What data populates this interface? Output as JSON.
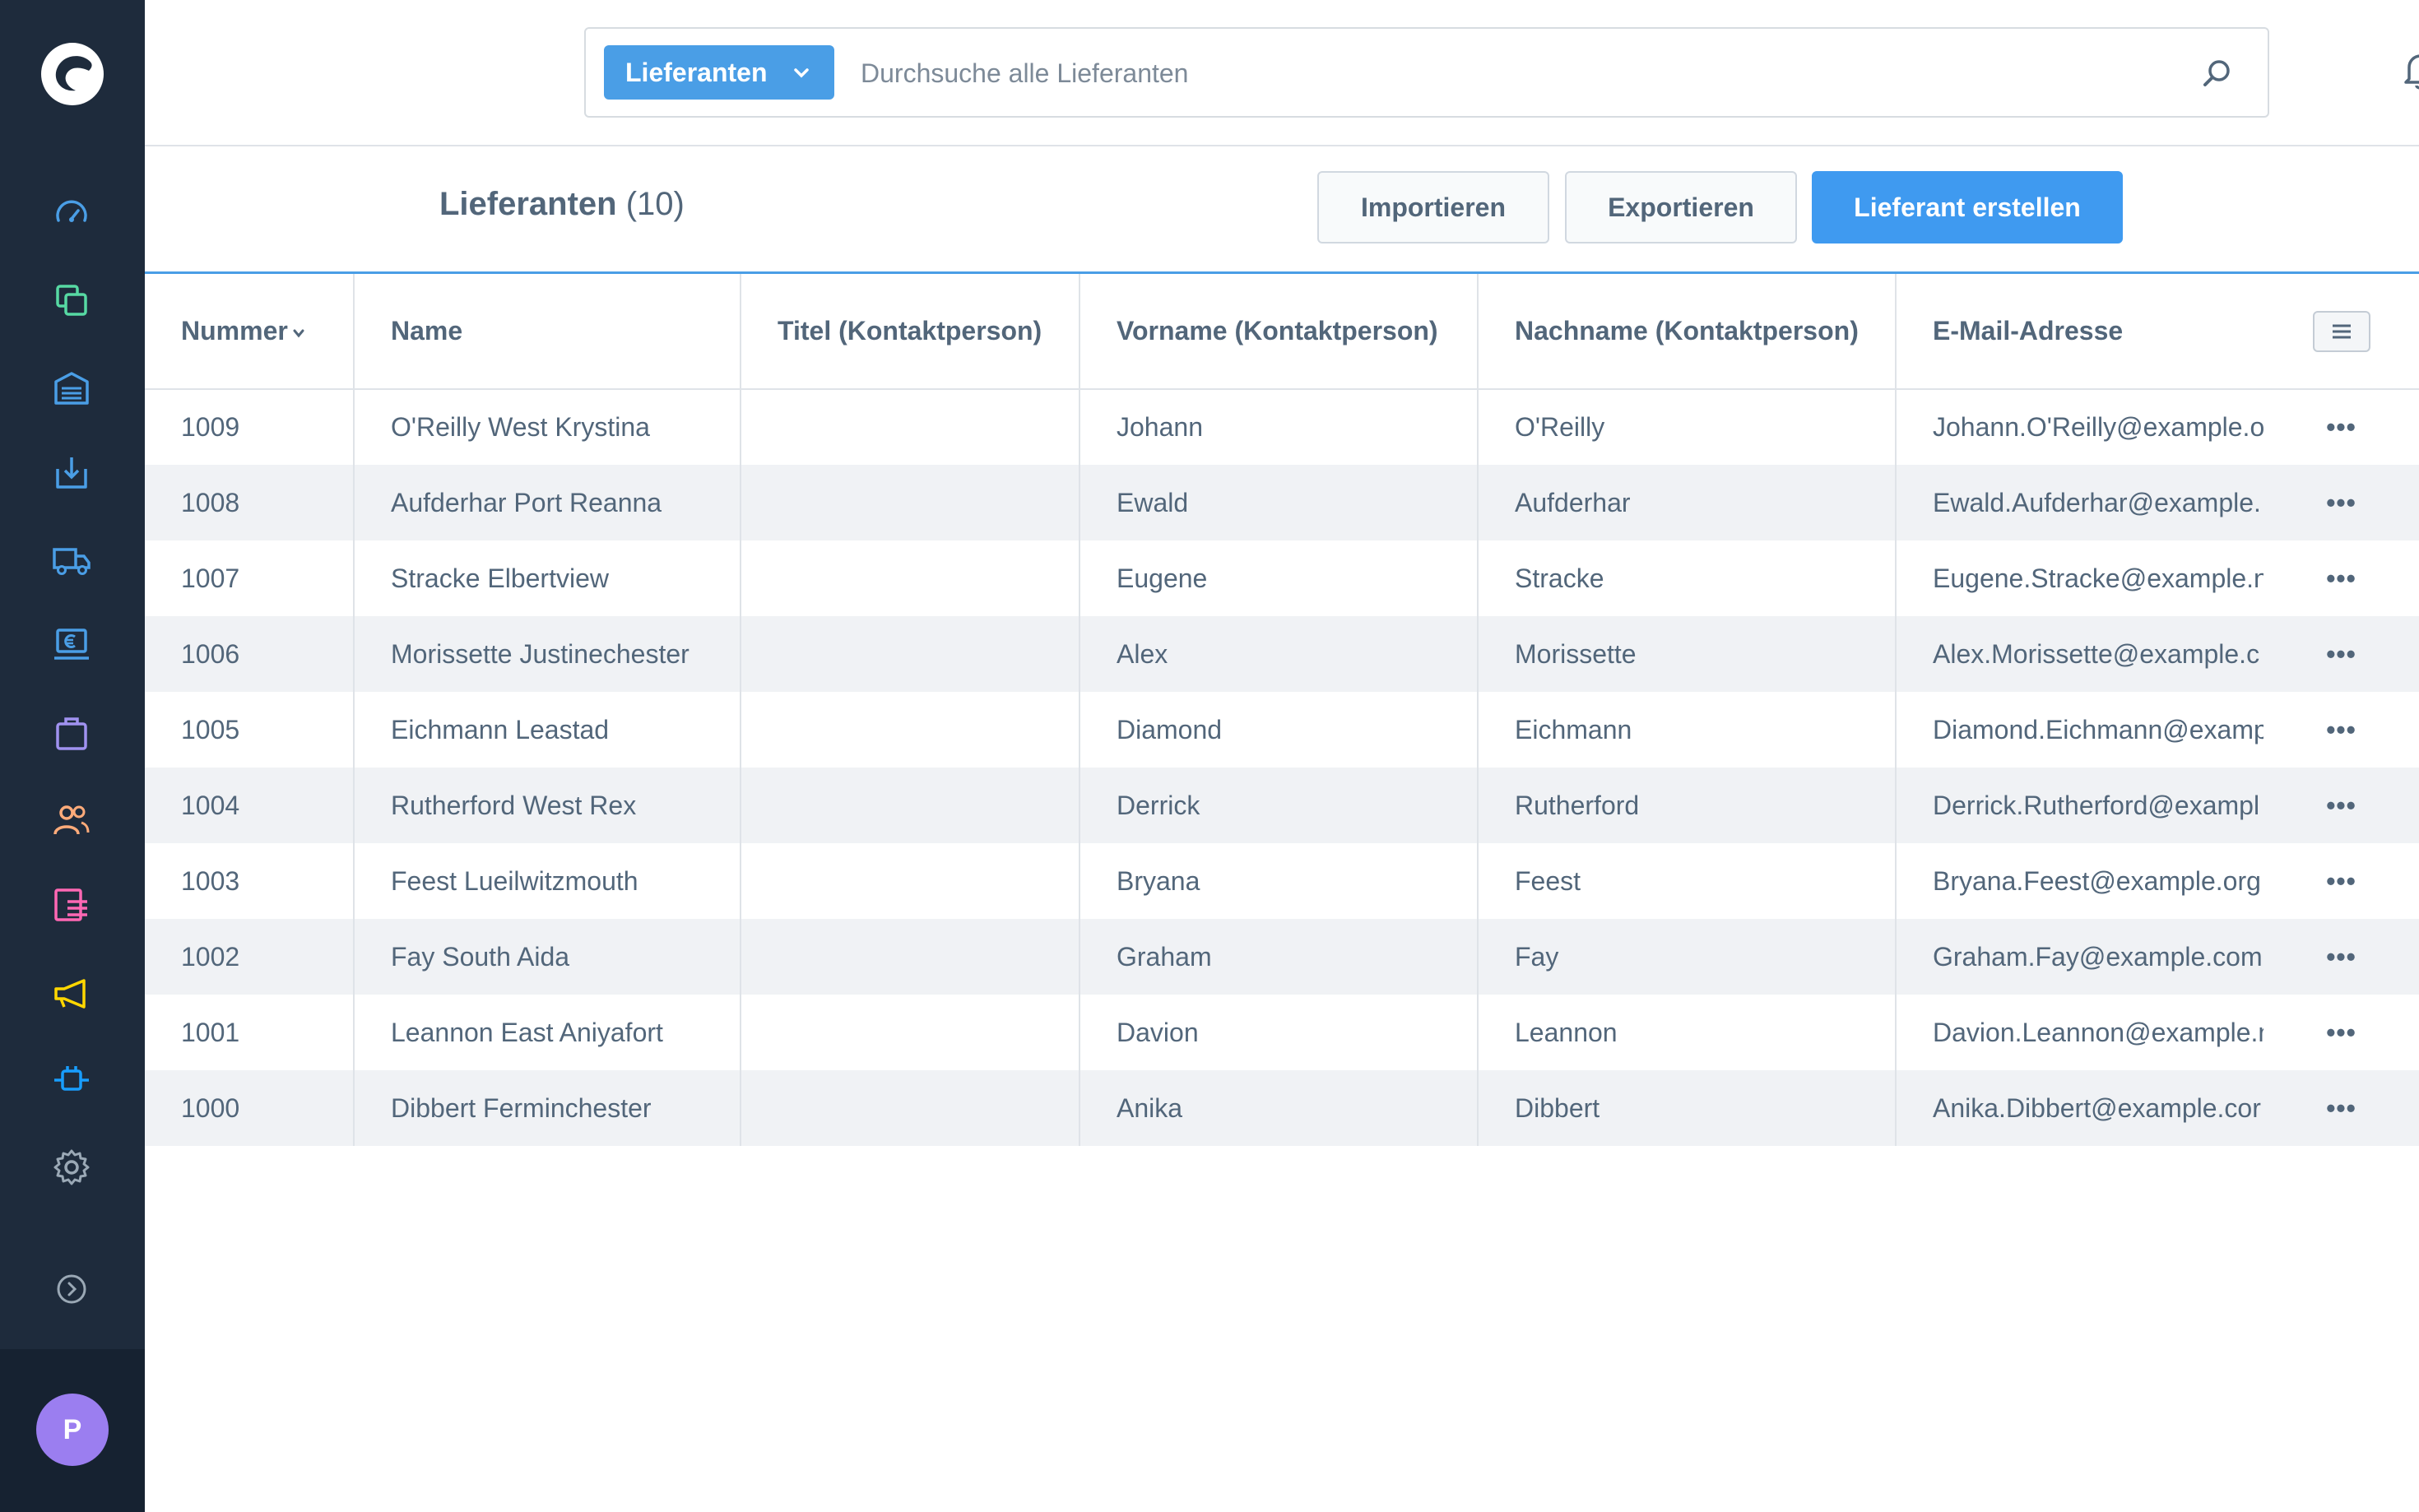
{
  "colors": {
    "sidebar_bg": "#1e2b3c",
    "accent": "#3f9af0",
    "avatar_bg": "#9b7ef0",
    "text": "#52667a"
  },
  "sidebar": {
    "items": [
      {
        "icon": "dashboard-icon",
        "color": "#4a9ee6"
      },
      {
        "icon": "catalogues-icon",
        "color": "#57d9a3"
      },
      {
        "icon": "warehouse-icon",
        "color": "#4a9ee6"
      },
      {
        "icon": "incoming-goods-icon",
        "color": "#4a9ee6"
      },
      {
        "icon": "shipping-truck-icon",
        "color": "#4a9ee6"
      },
      {
        "icon": "accounting-icon",
        "color": "#4a9ee6"
      },
      {
        "icon": "orders-bag-icon",
        "color": "#a092f0"
      },
      {
        "icon": "customers-icon",
        "color": "#ffab7a"
      },
      {
        "icon": "content-icon",
        "color": "#ff68b4"
      },
      {
        "icon": "marketing-megaphone-icon",
        "color": "#ffd700"
      },
      {
        "icon": "extensions-plug-icon",
        "color": "#189eff"
      },
      {
        "icon": "settings-gear-icon",
        "color": "#9aa8b5"
      }
    ],
    "expand_icon": "chevron-right-circle-icon",
    "avatar_letter": "P"
  },
  "search": {
    "type_label": "Lieferanten",
    "placeholder": "Durchsuche alle Lieferanten",
    "value": ""
  },
  "header": {
    "title": "Lieferanten",
    "count": "(10)",
    "import_label": "Importieren",
    "export_label": "Exportieren",
    "create_label": "Lieferant erstellen"
  },
  "table": {
    "columns": [
      "Nummer",
      "Name",
      "Titel (Kontaktperson)",
      "Vorname (Kontaktperson)",
      "Nachname (Kontaktperson)",
      "E-Mail-Adresse"
    ],
    "rows": [
      {
        "number": "1009",
        "name": "O'Reilly West Krystina",
        "title": "",
        "firstname": "Johann",
        "lastname": "O'Reilly",
        "email": "Johann.O'Reilly@example.o"
      },
      {
        "number": "1008",
        "name": "Aufderhar Port Reanna",
        "title": "",
        "firstname": "Ewald",
        "lastname": "Aufderhar",
        "email": "Ewald.Aufderhar@example."
      },
      {
        "number": "1007",
        "name": "Stracke Elbertview",
        "title": "",
        "firstname": "Eugene",
        "lastname": "Stracke",
        "email": "Eugene.Stracke@example.n"
      },
      {
        "number": "1006",
        "name": "Morissette Justinechester",
        "title": "",
        "firstname": "Alex",
        "lastname": "Morissette",
        "email": "Alex.Morissette@example.c"
      },
      {
        "number": "1005",
        "name": "Eichmann Leastad",
        "title": "",
        "firstname": "Diamond",
        "lastname": "Eichmann",
        "email": "Diamond.Eichmann@examp"
      },
      {
        "number": "1004",
        "name": "Rutherford West Rex",
        "title": "",
        "firstname": "Derrick",
        "lastname": "Rutherford",
        "email": "Derrick.Rutherford@exampl"
      },
      {
        "number": "1003",
        "name": "Feest Lueilwitzmouth",
        "title": "",
        "firstname": "Bryana",
        "lastname": "Feest",
        "email": "Bryana.Feest@example.org"
      },
      {
        "number": "1002",
        "name": "Fay South Aida",
        "title": "",
        "firstname": "Graham",
        "lastname": "Fay",
        "email": "Graham.Fay@example.com"
      },
      {
        "number": "1001",
        "name": "Leannon East Aniyafort",
        "title": "",
        "firstname": "Davion",
        "lastname": "Leannon",
        "email": "Davion.Leannon@example.n"
      },
      {
        "number": "1000",
        "name": "Dibbert Ferminchester",
        "title": "",
        "firstname": "Anika",
        "lastname": "Dibbert",
        "email": "Anika.Dibbert@example.cor"
      }
    ]
  }
}
